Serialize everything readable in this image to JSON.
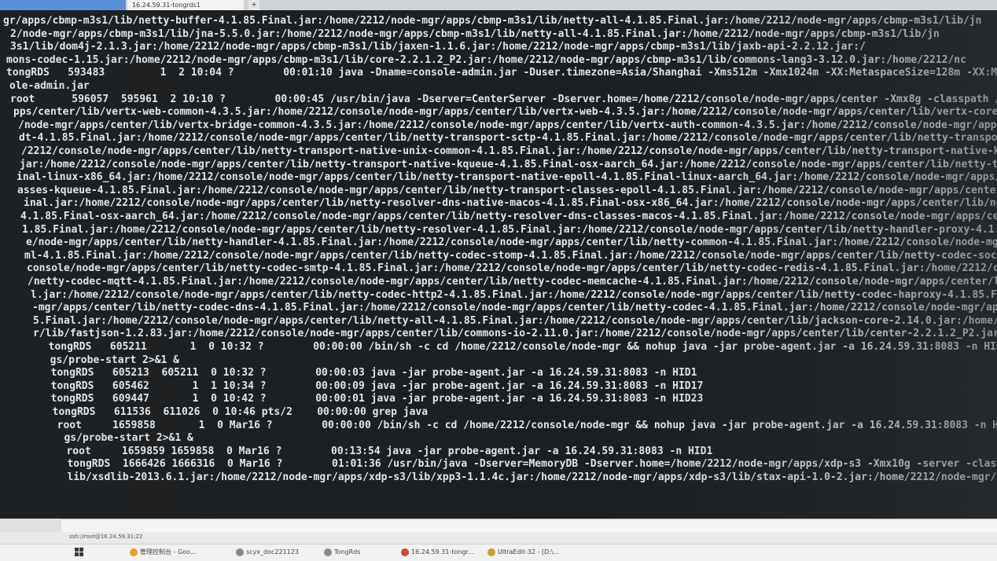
{
  "tabs": {
    "first": "",
    "active": "16.24.59.31-tongrds1",
    "add": "+"
  },
  "terminal_lines": [
    "gr/apps/cbmp-m3s1/lib/netty-buffer-4.1.85.Final.jar:/home/2212/node-mgr/apps/cbmp-m3s1/lib/netty-all-4.1.85.Final.jar:/home/2212/node-mgr/apps/cbmp-m3s1/lib/jn",
    "2/node-mgr/apps/cbmp-m3s1/lib/jna-5.5.0.jar:/home/2212/node-mgr/apps/cbmp-m3s1/lib/netty-all-4.1.85.Final.jar:/home/2212/node-mgr/apps/cbmp-m3s1/lib/jn",
    "3s1/lib/dom4j-2.1.3.jar:/home/2212/node-mgr/apps/cbmp-m3s1/lib/jaxen-1.1.6.jar:/home/2212/node-mgr/apps/cbmp-m3s1/lib/jaxb-api-2.2.12.jar:/",
    "mons-codec-1.15.jar:/home/2212/node-mgr/apps/cbmp-m3s1/lib/core-2.2.1.2_P2.jar:/home/2212/node-mgr/apps/cbmp-m3s1/lib/commons-lang3-3.12.0.jar:/home/2212/nc",
    "tongRDS   593483         1  2 10:04 ?        00:01:10 java -Dname=console-admin.jar -Duser.timezone=Asia/Shanghai -Xms512m -Xmx1024m -XX:MetaspaceSize=128m -XX:Max",
    "ole-admin.jar",
    "root      596057  595961  2 10:10 ?        00:00:45 /usr/bin/java -Dserver=CenterServer -Dserver.home=/home/2212/console/node-mgr/apps/center -Xmx8g -classpath /",
    "pps/center/lib/vertx-web-common-4.3.5.jar:/home/2212/console/node-mgr/apps/center/lib/vertx-web-4.3.5.jar:/home/2212/console/node-mgr/apps/center/lib/vertx-core-4",
    "/node-mgr/apps/center/lib/vertx-bridge-common-4.3.5.jar:/home/2212/console/node-mgr/apps/center/lib/vertx-auth-common-4.3.5.jar:/home/2212/console/node-mgr/apps/c",
    "dt-4.1.85.Final.jar:/home/2212/console/node-mgr/apps/center/lib/netty-transport-sctp-4.1.85.Final.jar:/home/2212/console/node-mgr/apps/center/lib/netty-transport-n",
    "/2212/console/node-mgr/apps/center/lib/netty-transport-native-unix-common-4.1.85.Final.jar:/home/2212/console/node-mgr/apps/center/lib/netty-transport-native-kqueu",
    "jar:/home/2212/console/node-mgr/apps/center/lib/netty-transport-native-kqueue-4.1.85.Final-osx-aarch_64.jar:/home/2212/console/node-mgr/apps/center/lib/netty-trans",
    "inal-linux-x86_64.jar:/home/2212/console/node-mgr/apps/center/lib/netty-transport-native-epoll-4.1.85.Final-linux-aarch_64.jar:/home/2212/console/node-mgr/apps/cent",
    "asses-kqueue-4.1.85.Final.jar:/home/2212/console/node-mgr/apps/center/lib/netty-transport-classes-epoll-4.1.85.Final.jar:/home/2212/console/node-mgr/apps/center/lib",
    "inal.jar:/home/2212/console/node-mgr/apps/center/lib/netty-resolver-dns-native-macos-4.1.85.Final-osx-x86_64.jar:/home/2212/console/node-mgr/apps/center/lib/netty-",
    "4.1.85.Final-osx-aarch_64.jar:/home/2212/console/node-mgr/apps/center/lib/netty-resolver-dns-classes-macos-4.1.85.Final.jar:/home/2212/console/node-mgr/apps/center/l",
    "1.85.Final.jar:/home/2212/console/node-mgr/apps/center/lib/netty-resolver-4.1.85.Final.jar:/home/2212/console/node-mgr/apps/center/lib/netty-handler-proxy-4.1.85.Fi",
    "e/node-mgr/apps/center/lib/netty-handler-4.1.85.Final.jar:/home/2212/console/node-mgr/apps/center/lib/netty-common-4.1.85.Final.jar:/home/2212/console/node-mgr/apps/",
    "ml-4.1.85.Final.jar:/home/2212/console/node-mgr/apps/center/lib/netty-codec-stomp-4.1.85.Final.jar:/home/2212/console/node-mgr/apps/center/lib/netty-codec-socks-4.1.8",
    "console/node-mgr/apps/center/lib/netty-codec-smtp-4.1.85.Final.jar:/home/2212/console/node-mgr/apps/center/lib/netty-codec-redis-4.1.85.Final.jar:/home/2212/console",
    "/netty-codec-mqtt-4.1.85.Final.jar:/home/2212/console/node-mgr/apps/center/lib/netty-codec-memcache-4.1.85.Final.jar:/home/2212/console/node-mgr/apps/center/lib/netty-",
    "l.jar:/home/2212/console/node-mgr/apps/center/lib/netty-codec-http2-4.1.85.Final.jar:/home/2212/console/node-mgr/apps/center/lib/netty-codec-haproxy-4.1.85.Final.jar:/",
    "-mgr/apps/center/lib/netty-codec-dns-4.1.85.Final.jar:/home/2212/console/node-mgr/apps/center/lib/netty-codec-4.1.85.Final.jar:/home/2212/console/node-mgr/apps/center/l",
    "5.Final.jar:/home/2212/console/node-mgr/apps/center/lib/netty-all-4.1.85.Final.jar:/home/2212/console/node-mgr/apps/center/lib/jackson-core-2.14.0.jar:/home/2212/consol",
    "r/lib/fastjson-1.2.83.jar:/home/2212/console/node-mgr/apps/center/lib/commons-io-2.11.0.jar:/home/2212/console/node-mgr/apps/center/lib/center-2.2.1.2_P2.jar: com.center",
    "  tongRDS   605211       1  0 10:32 ?        00:00:00 /bin/sh -c cd /home/2212/console/node-mgr && nohup java -jar probe-agent.jar -a 16.24.59.31:8083 -n HID1 > /home/2212/",
    "  gs/probe-start 2>&1 &",
    "  tongRDS   605213  605211  0 10:32 ?        00:00:03 java -jar probe-agent.jar -a 16.24.59.31:8083 -n HID1",
    "  tongRDS   605462       1  1 10:34 ?        00:00:09 java -jar probe-agent.jar -a 16.24.59.31:8083 -n HID17",
    "  tongRDS   609447       1  0 10:42 ?        00:00:01 java -jar probe-agent.jar -a 16.24.59.31:8083 -n HID23",
    "  tongRDS   611536  611026  0 10:46 pts/2    00:00:00 grep java",
    "  root     1659858       1  0 Mar16 ?        00:00:00 /bin/sh -c cd /home/2212/console/node-mgr && nohup java -jar probe-agent.jar -a 16.24.59.31:8083 -n HID1 > /home/2212/co",
    "   gs/probe-start 2>&1 &",
    "   root     1659859 1659858  0 Mar16 ?        00:13:54 java -jar probe-agent.jar -a 16.24.59.31:8083 -n HID1",
    "   tongRDS  1666426 1666316  0 Mar16 ?        01:01:36 /usr/bin/java -Dserver=MemoryDB -Dserver.home=/home/2212/node-mgr/apps/xdp-s3 -Xmx10g -server -classpath /home/2212/node-",
    "   lib/xsdlib-2013.6.1.jar:/home/2212/node-mgr/apps/xdp-s3/lib/xpp3-1.1.4c.jar:/home/2212/node-mgr/apps/xdp-s3/lib/stax-api-1.0-2.jar:/home/2212/node-mgr/apps/xdp-s3/lib/sl4j-"
  ],
  "status": {
    "connection": "ssh://root@16.24.59.31:22"
  },
  "taskbar": {
    "items": [
      {
        "label": "管理控制台 - Goo...",
        "color": "#e3a21a"
      },
      {
        "label": "scyx_doc221123",
        "color": "#888888"
      },
      {
        "label": "TongRds",
        "color": "#888888"
      },
      {
        "label": "16.24.59.31-tongr...",
        "color": "#d9433a"
      },
      {
        "label": "UltraEdit-32 - [D:\\...",
        "color": "#c9a227"
      }
    ]
  }
}
